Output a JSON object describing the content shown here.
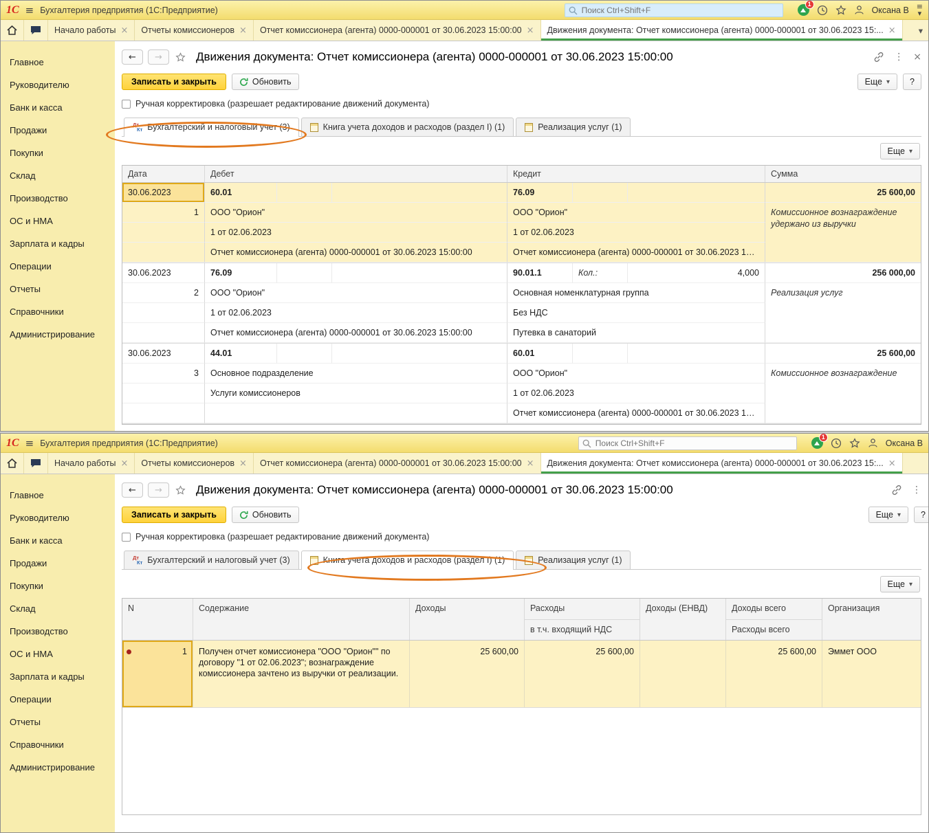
{
  "app": {
    "logo": "1С",
    "window_title": "Бухгалтерия предприятия  (1С:Предприятие)",
    "search_placeholder": "Поиск Ctrl+Shift+F",
    "notification_badge": "1",
    "user_name": "Оксана В"
  },
  "icons": {
    "burger": "≡",
    "caret_down": "▾",
    "back_arrow": "←",
    "forward_arrow": "→",
    "kebab": "⋮",
    "close": "×",
    "dt": "Дт",
    "kt": "Кт"
  },
  "top_tabs": {
    "tab0": "Начало работы",
    "tab1": "Отчеты комиссионеров",
    "tab2": "Отчет комиссионера (агента) 0000-000001 от 30.06.2023 15:00:00",
    "tab3": "Движения документа: Отчет комиссионера (агента) 0000-000001 от 30.06.2023 15:..."
  },
  "sidebar": {
    "items": [
      "Главное",
      "Руководителю",
      "Банк и касса",
      "Продажи",
      "Покупки",
      "Склад",
      "Производство",
      "ОС и НМА",
      "Зарплата и кадры",
      "Операции",
      "Отчеты",
      "Справочники",
      "Администрирование"
    ]
  },
  "page": {
    "title": "Движения документа: Отчет комиссионера (агента) 0000-000001 от 30.06.2023 15:00:00",
    "btn_save_close": "Записать и закрыть",
    "btn_refresh": "Обновить",
    "btn_more": "Еще",
    "btn_help": "?",
    "checkbox_label": "Ручная корректировка (разрешает редактирование движений документа)",
    "tab_accounting": "Бухгалтерский и налоговый учет (3)",
    "tab_kudir": "Книга учета доходов и расходов (раздел I) (1)",
    "tab_services": "Реализация услуг (1)"
  },
  "table1": {
    "col_date": "Дата",
    "col_debit": "Дебет",
    "col_credit": "Кредит",
    "col_sum": "Сумма",
    "rows": [
      {
        "date": "30.06.2023",
        "num": "1",
        "debit_account": "60.01",
        "debit_sub1": "ООО \"Орион\"",
        "debit_sub2": "1 от 02.06.2023",
        "debit_sub3": "Отчет комиссионера (агента) 0000-000001 от 30.06.2023 15:00:00",
        "credit_account": "76.09",
        "credit_sub1": "ООО \"Орион\"",
        "credit_sub2": "1 от 02.06.2023",
        "credit_sub3": "Отчет комиссионера (агента) 0000-000001 от 30.06.2023 1…",
        "amount": "25 600,00",
        "note": "Комиссионное вознаграждение удержано из выручки"
      },
      {
        "date": "30.06.2023",
        "num": "2",
        "debit_account": "76.09",
        "debit_sub1": "ООО \"Орион\"",
        "debit_sub2": "1 от 02.06.2023",
        "debit_sub3": "Отчет комиссионера (агента) 0000-000001 от 30.06.2023 15:00:00",
        "credit_account": "90.01.1",
        "qty_label": "Кол.:",
        "qty": "4,000",
        "credit_sub1": "Основная номенклатурная группа",
        "credit_sub2": "Без НДС",
        "credit_sub3": "Путевка в санаторий",
        "amount": "256 000,00",
        "note": "Реализация услуг"
      },
      {
        "date": "30.06.2023",
        "num": "3",
        "debit_account": "44.01",
        "debit_sub1": "Основное подразделение",
        "debit_sub2": "Услуги комиссионеров",
        "debit_sub3": "",
        "credit_account": "60.01",
        "credit_sub1": "ООО \"Орион\"",
        "credit_sub2": "1 от 02.06.2023",
        "credit_sub3": "Отчет комиссионера (агента) 0000-000001 от 30.06.2023 1…",
        "amount": "25 600,00",
        "note": "Комиссионное вознаграждение"
      }
    ]
  },
  "table2": {
    "col_n": "N",
    "col_content": "Содержание",
    "col_income": "Доходы",
    "col_expense": "Расходы",
    "col_expense_sub": "в т.ч. входящий НДС",
    "col_income_envd": "Доходы (ЕНВД)",
    "col_income_total": "Доходы всего",
    "col_expense_total": "Расходы всего",
    "col_org": "Организация",
    "row": {
      "num": "1",
      "content": "Получен отчет комиссионера \"ООО \"Орион\"\" по договору \"1 от 02.06.2023\"; вознаграждение комиссионера зачтено из выручки от реализации.",
      "income": "25 600,00",
      "expense": "25 600,00",
      "income_envd": "",
      "income_total": "25 600,00",
      "org": "Эммет ООО"
    }
  }
}
